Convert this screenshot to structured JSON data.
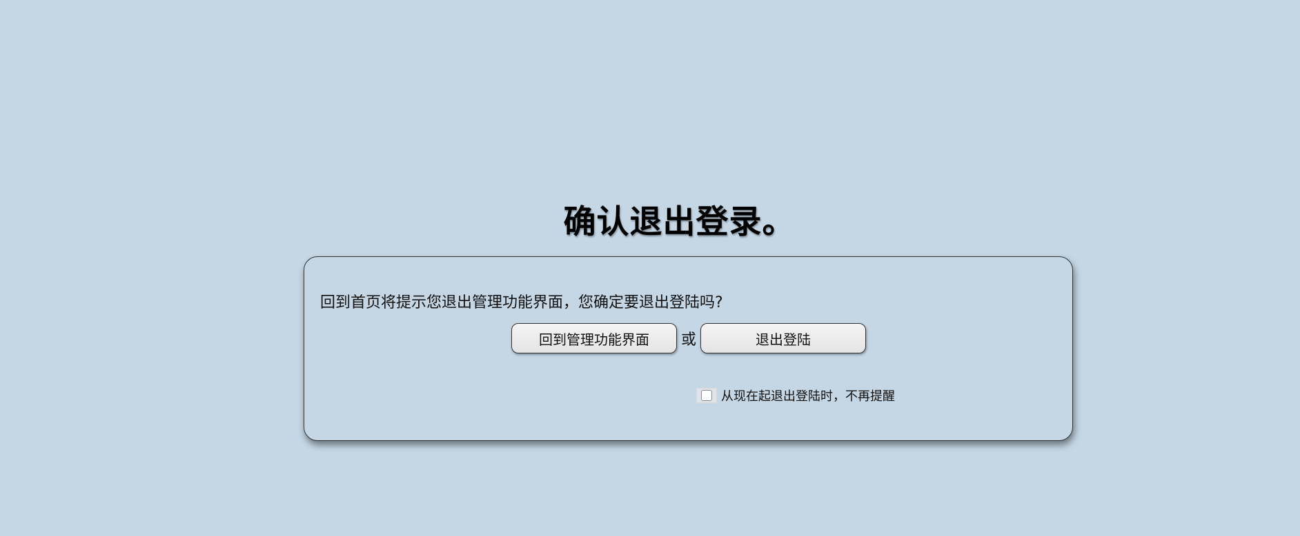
{
  "page": {
    "title": "确认退出登录。"
  },
  "dialog": {
    "prompt": "回到首页将提示您退出管理功能界面，您确定要退出登陆吗?",
    "back_button_label": "回到管理功能界面",
    "or_text": "或",
    "logout_button_label": "退出登陆",
    "dont_remind": {
      "checked": false,
      "label": "从现在起退出登陆时，不再提醒"
    }
  },
  "colors": {
    "background": "#c5d7e5",
    "button_face": "#eeeeee",
    "border": "#333333"
  }
}
